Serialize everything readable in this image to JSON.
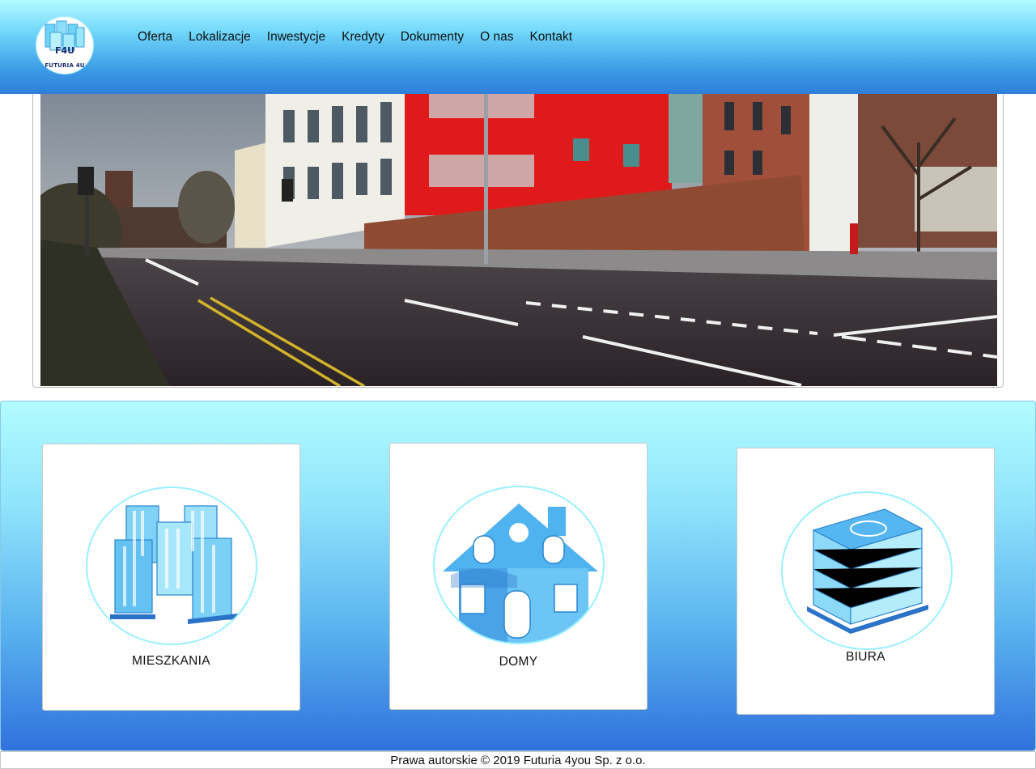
{
  "brand": {
    "logo_mark": "F4U",
    "logo_caption": "FUTURIA 4U"
  },
  "nav": {
    "items": [
      {
        "label": "Oferta"
      },
      {
        "label": "Lokalizacje"
      },
      {
        "label": "Inwestycje"
      },
      {
        "label": "Kredyty"
      },
      {
        "label": "Dokumenty"
      },
      {
        "label": "O nas"
      },
      {
        "label": "Kontakt"
      }
    ]
  },
  "hero": {
    "image": "street-corner-apartment-buildings"
  },
  "categories": [
    {
      "label": "MIESZKANIA",
      "icon": "apartment-blocks-icon"
    },
    {
      "label": "DOMY",
      "icon": "house-icon"
    },
    {
      "label": "BIURA",
      "icon": "office-building-icon"
    }
  ],
  "footer": {
    "copyright": "Prawa autorskie © 2019 Futuria 4you Sp. z o.o."
  },
  "colors": {
    "header_top": "#b3fbff",
    "header_bottom": "#2f7fd9",
    "band_top": "#b2fcff",
    "band_bottom": "#3072dd",
    "icon_accent": "#5fc8f5"
  }
}
